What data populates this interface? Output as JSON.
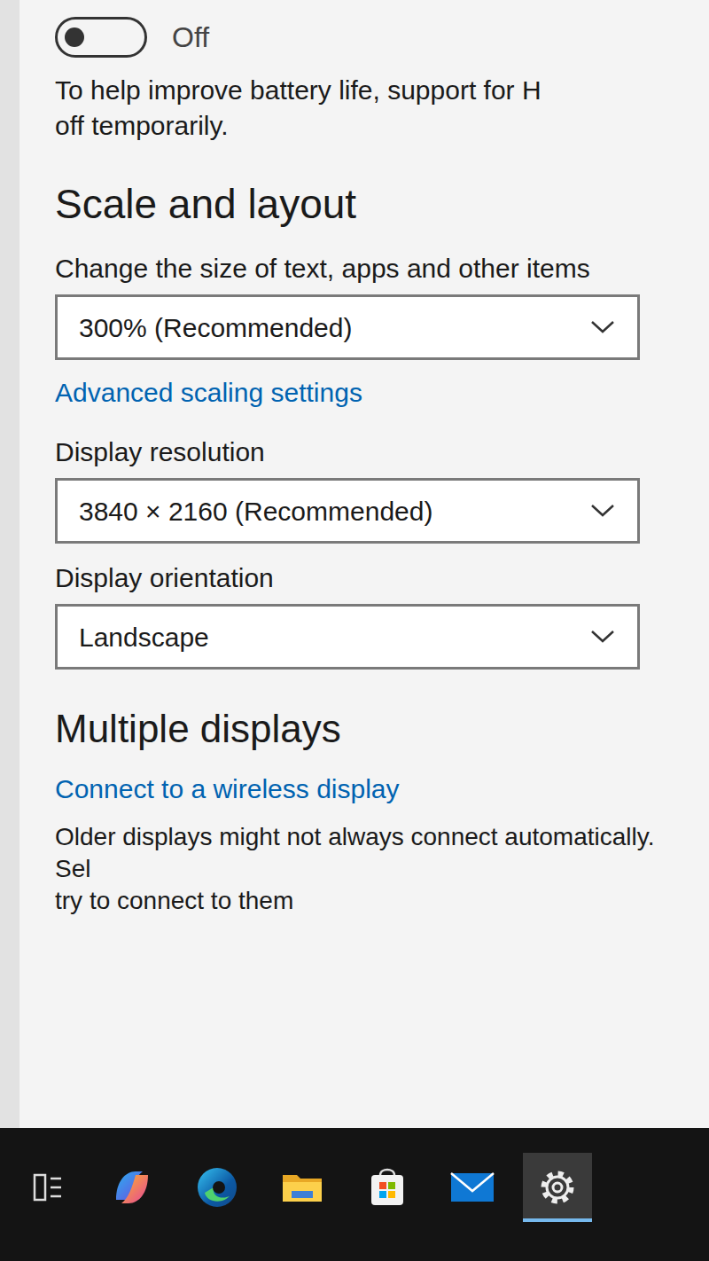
{
  "toggle": {
    "on": false,
    "label": "Off"
  },
  "battery_note": [
    "To help improve battery life, support for H",
    "off temporarily."
  ],
  "scale_layout": {
    "heading": "Scale and layout",
    "scale_label": "Change the size of text, apps and other items",
    "scale_value": "300% (Recommended)",
    "advanced_link": "Advanced scaling settings",
    "resolution_label": "Display resolution",
    "resolution_value": "3840 × 2160 (Recommended)",
    "orientation_label": "Display orientation",
    "orientation_value": "Landscape"
  },
  "multiple_displays": {
    "heading": "Multiple displays",
    "link": "Connect to a wireless display",
    "note": [
      "Older displays might not always connect automatically. Sel",
      "try to connect to them"
    ]
  },
  "taskbar": {
    "items": [
      {
        "kind": "taskview",
        "selected": false
      },
      {
        "kind": "copilot",
        "selected": false
      },
      {
        "kind": "edge",
        "selected": false
      },
      {
        "kind": "explorer",
        "selected": false
      },
      {
        "kind": "store",
        "selected": false
      },
      {
        "kind": "mail",
        "selected": false
      },
      {
        "kind": "settings",
        "selected": true
      }
    ]
  }
}
